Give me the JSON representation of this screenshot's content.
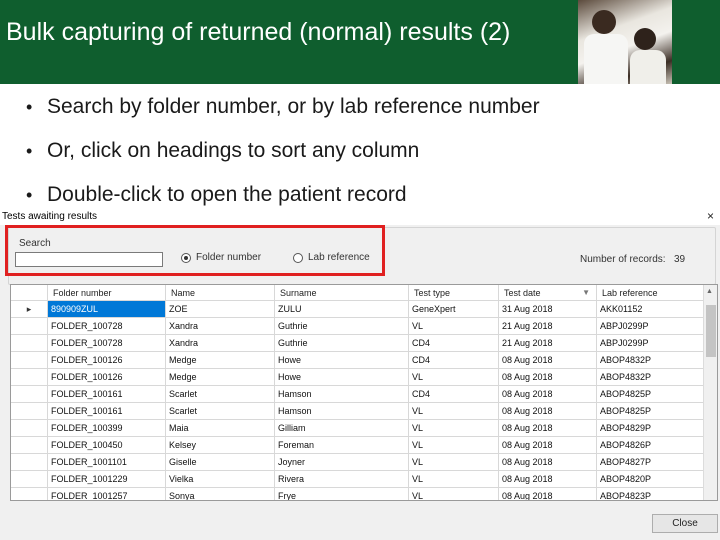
{
  "slide": {
    "title": "Bulk capturing of returned (normal) results (2)",
    "bullets": [
      "Search by folder number, or by lab reference number",
      "Or, click on headings to sort any column",
      "Double-click to open the patient record"
    ]
  },
  "window": {
    "title": "Tests awaiting results",
    "close_glyph": "×",
    "search": {
      "label": "Search",
      "value": "",
      "options": [
        "Folder number",
        "Lab reference"
      ],
      "selected": "Folder number"
    },
    "records_label": "Number of records:",
    "records_count": "39",
    "columns": [
      "Folder number",
      "Name",
      "Surname",
      "Test type",
      "Test date",
      "Lab reference"
    ],
    "sorted_column": "Test date",
    "rows": [
      [
        "890909ZUL",
        "ZOE",
        "ZULU",
        "GeneXpert",
        "31 Aug 2018",
        "AKK01152"
      ],
      [
        "FOLDER_100728",
        "Xandra",
        "Guthrie",
        "VL",
        "21 Aug 2018",
        "ABPJ0299P"
      ],
      [
        "FOLDER_100728",
        "Xandra",
        "Guthrie",
        "CD4",
        "21 Aug 2018",
        "ABPJ0299P"
      ],
      [
        "FOLDER_100126",
        "Medge",
        "Howe",
        "CD4",
        "08 Aug 2018",
        "ABOP4832P"
      ],
      [
        "FOLDER_100126",
        "Medge",
        "Howe",
        "VL",
        "08 Aug 2018",
        "ABOP4832P"
      ],
      [
        "FOLDER_100161",
        "Scarlet",
        "Hamson",
        "CD4",
        "08 Aug 2018",
        "ABOP4825P"
      ],
      [
        "FOLDER_100161",
        "Scarlet",
        "Hamson",
        "VL",
        "08 Aug 2018",
        "ABOP4825P"
      ],
      [
        "FOLDER_100399",
        "Maia",
        "Gilliam",
        "VL",
        "08 Aug 2018",
        "ABOP4829P"
      ],
      [
        "FOLDER_100450",
        "Kelsey",
        "Foreman",
        "VL",
        "08 Aug 2018",
        "ABOP4826P"
      ],
      [
        "FOLDER_1001101",
        "Giselle",
        "Joyner",
        "VL",
        "08 Aug 2018",
        "ABOP4827P"
      ],
      [
        "FOLDER_1001229",
        "Vielka",
        "Rivera",
        "VL",
        "08 Aug 2018",
        "ABOP4820P"
      ],
      [
        "FOLDER_1001257",
        "Sonya",
        "Frye",
        "VL",
        "08 Aug 2018",
        "ABOP4823P"
      ]
    ],
    "selected_row": 0,
    "close_label": "Close"
  },
  "colors": {
    "header_bg": "#0f5e2e",
    "selection": "#0078d7",
    "highlight_box": "#e02020"
  }
}
